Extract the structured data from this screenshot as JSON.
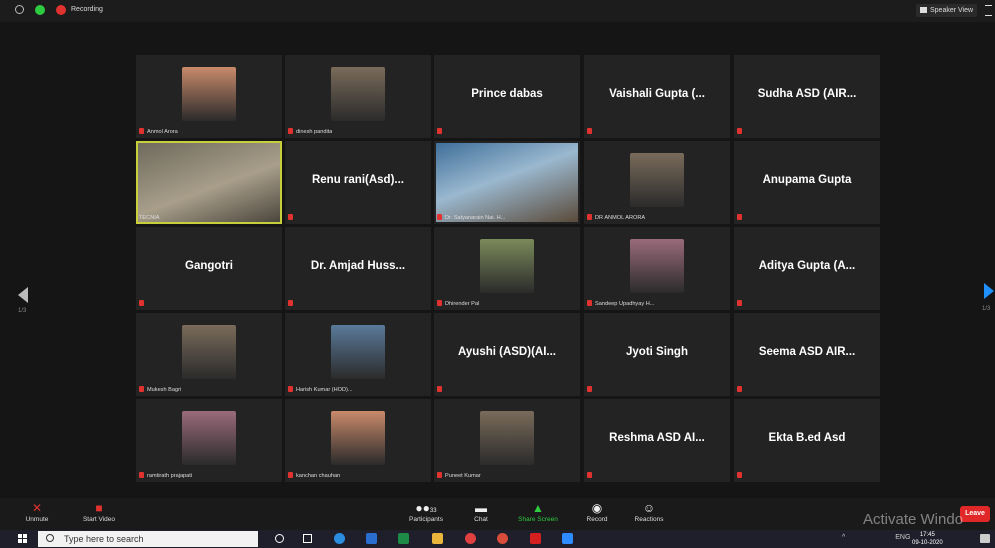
{
  "topbar": {
    "recording_label": "Recording",
    "speaker_view_label": "Speaker View"
  },
  "gallery": {
    "page_left": "1/3",
    "page_right": "1/3",
    "tiles": [
      {
        "name": "Anmol Arora",
        "video": "avatar",
        "muted": true
      },
      {
        "name": "dinesh pandita",
        "video": "avatar",
        "muted": true
      },
      {
        "display": "Prince dabas",
        "name": "",
        "muted": true
      },
      {
        "display": "Vaishali Gupta (...",
        "name": "",
        "muted": true
      },
      {
        "display": "Sudha ASD (AIR...",
        "name": "",
        "muted": true
      },
      {
        "name": "TECNIA",
        "video": "camera",
        "muted": false,
        "active": true
      },
      {
        "display": "Renu rani(Asd)...",
        "name": "",
        "muted": true
      },
      {
        "name": "Dr. Satyanarain Nai. H...",
        "video": "camera",
        "muted": true
      },
      {
        "name": "DR ANMOL ARORA",
        "video": "avatar",
        "muted": true
      },
      {
        "display": "Anupama Gupta",
        "name": "",
        "muted": true
      },
      {
        "display": "Gangotri",
        "name": "",
        "muted": true
      },
      {
        "display": "Dr. Amjad Huss...",
        "name": "",
        "muted": true
      },
      {
        "name": "Dhirender Pal",
        "video": "avatar",
        "muted": true
      },
      {
        "name": "Sandeep Upadhyay H...",
        "video": "avatar",
        "muted": true
      },
      {
        "display": "Aditya Gupta (A...",
        "name": "",
        "muted": true
      },
      {
        "name": "Mukesh Bagri",
        "video": "avatar",
        "muted": true
      },
      {
        "name": "Harish Kumar (HOD)...",
        "video": "avatar",
        "muted": true
      },
      {
        "display": "Ayushi (ASD)(AI...",
        "name": "",
        "muted": true
      },
      {
        "display": "Jyoti Singh",
        "name": "",
        "muted": true
      },
      {
        "display": "Seema ASD AIR...",
        "name": "",
        "muted": true
      },
      {
        "name": "ramtirath prajapati",
        "video": "avatar",
        "muted": true
      },
      {
        "name": "kanchan chauhan",
        "video": "avatar",
        "muted": true
      },
      {
        "name": "Puneet Kumar",
        "video": "avatar",
        "muted": true
      },
      {
        "display": "Reshma ASD AI...",
        "name": "",
        "muted": true
      },
      {
        "display": "Ekta B.ed Asd",
        "name": "",
        "muted": true
      }
    ]
  },
  "toolbar": {
    "unmute": "Unmute",
    "start_video": "Start Video",
    "participants": "Participants",
    "participants_count": "33",
    "chat": "Chat",
    "share_screen": "Share Screen",
    "record": "Record",
    "reactions": "Reactions",
    "leave": "Leave"
  },
  "watermark": "Activate Windo",
  "taskbar": {
    "search_placeholder": "Type here to search",
    "time": "17:45",
    "date": "09-10-2020",
    "lang": "ENG"
  },
  "colors": {
    "active_speaker": "#c7cf3a",
    "muted": "#e0322f",
    "leave": "#e02828",
    "share": "#2ecc40"
  }
}
